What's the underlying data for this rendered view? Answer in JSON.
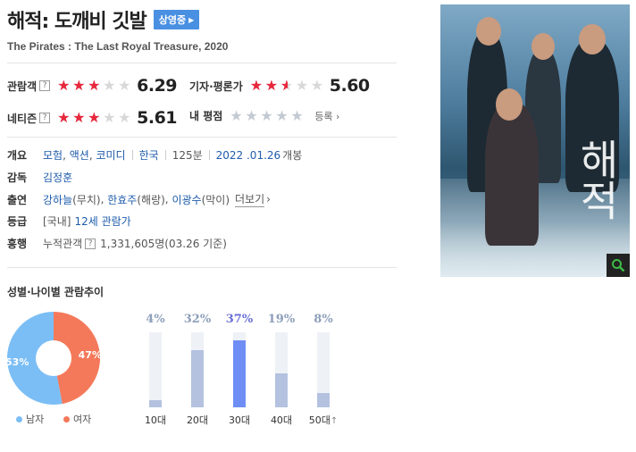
{
  "title": "해적: 도깨비 깃발",
  "badge": "상영중",
  "subtitle": "The Pirates : The Last Royal Treasure, 2020",
  "ratings": {
    "audience": {
      "label": "관람객",
      "score": "6.29",
      "stars": 3
    },
    "critic": {
      "label": "기자·평론가",
      "score": "5.60",
      "stars": 2.5
    },
    "netizen": {
      "label": "네티즌",
      "score": "5.61",
      "stars": 3
    },
    "mine": {
      "label": "내 평점",
      "login": "등록"
    }
  },
  "info": {
    "summary_label": "개요",
    "genres": [
      "모험",
      "액션",
      "코미디"
    ],
    "country": "한국",
    "runtime": "125분",
    "release_date": "2022 .01.26",
    "release_suffix": "개봉",
    "director_label": "감독",
    "director": "김정훈",
    "cast_label": "출연",
    "cast": [
      {
        "name": "강하늘",
        "role": "(무치)"
      },
      {
        "name": "한효주",
        "role": "(해랑)"
      },
      {
        "name": "이광수",
        "role": "(막이)"
      }
    ],
    "cast_more": "더보기",
    "grade_label": "등급",
    "grade_region": "[국내]",
    "grade": "12세 관람가",
    "boxoffice_label": "흥행",
    "boxoffice_prefix": "누적관객",
    "boxoffice_value": "1,331,605명",
    "boxoffice_date": "(03.26 기준)"
  },
  "poster": {
    "title_text": "해적"
  },
  "trend": {
    "title": "성별·나이별 관람추이",
    "gender": [
      {
        "label": "남자",
        "percent": 53,
        "color": "#7bbef5"
      },
      {
        "label": "여자",
        "percent": 47,
        "color": "#f4795a"
      }
    ],
    "age": [
      {
        "label": "10대",
        "percent": 4,
        "pct_text": "4%"
      },
      {
        "label": "20대",
        "percent": 32,
        "pct_text": "32%"
      },
      {
        "label": "30대",
        "percent": 37,
        "pct_text": "37%",
        "highlight": true
      },
      {
        "label": "40대",
        "percent": 19,
        "pct_text": "19%"
      },
      {
        "label": "50대",
        "percent": 8,
        "pct_text": "8%"
      }
    ]
  },
  "colors": {
    "star_red": "#e8273c",
    "link_blue": "#1f5cab",
    "badge_blue": "#4a90e2"
  }
}
